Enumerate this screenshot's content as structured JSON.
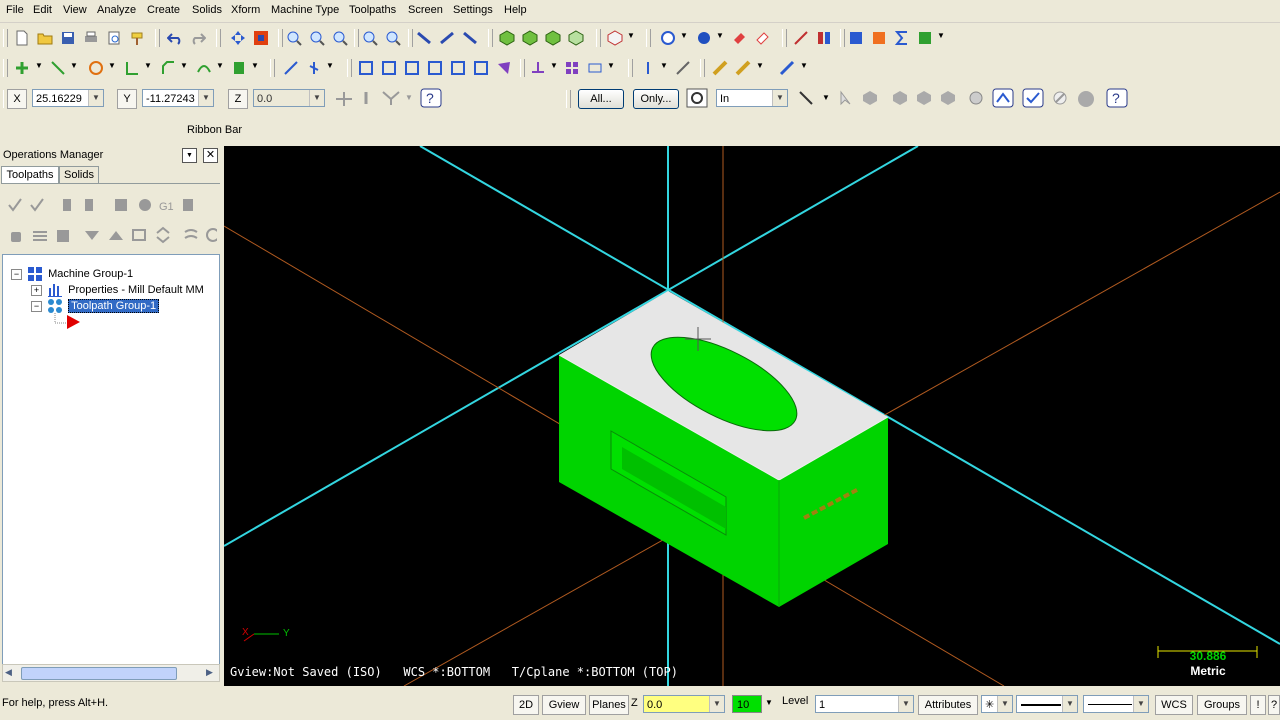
{
  "menu": [
    "File",
    "Edit",
    "View",
    "Analyze",
    "Create",
    "Solids",
    "Xform",
    "Machine Type",
    "Toolpaths",
    "Screen",
    "Settings",
    "Help"
  ],
  "coords": {
    "x_label": "X",
    "x_value": "25.16229",
    "y_label": "Y",
    "y_value": "-11.27243",
    "z_label": "Z",
    "z_value": "0.0"
  },
  "selection": {
    "all_label": "All...",
    "only_label": "Only...",
    "mode_value": "In"
  },
  "ribbon": {
    "label": "Ribbon Bar"
  },
  "ops": {
    "title": "Operations Manager",
    "tabs": [
      "Toolpaths",
      "Solids"
    ],
    "tree": {
      "machine_group": "Machine Group-1",
      "properties": "Properties - Mill Default MM",
      "toolpath_group": "Toolpath Group-1"
    }
  },
  "viewport": {
    "status": "Gview:Not Saved (ISO)   WCS *:BOTTOM   T/Cplane *:BOTTOM (TOP)",
    "scale_value": "30.886",
    "scale_unit": "Metric",
    "axis_x": "X",
    "axis_y": "Y",
    "colors": {
      "background": "#000000",
      "solid": "#00e000",
      "top_face": "#e6e6e6",
      "plane_lines": "#33d6e0",
      "axis_lines": "#b05a20"
    }
  },
  "status": {
    "help": "For help, press Alt+H.",
    "mode_2d": "2D",
    "gview": "Gview",
    "planes": "Planes",
    "z_label": "Z",
    "z_value": "0.0",
    "color_value": "10",
    "level_label": "Level",
    "level_value": "1",
    "attributes": "Attributes",
    "wcs": "WCS",
    "groups": "Groups",
    "bang": "!"
  }
}
